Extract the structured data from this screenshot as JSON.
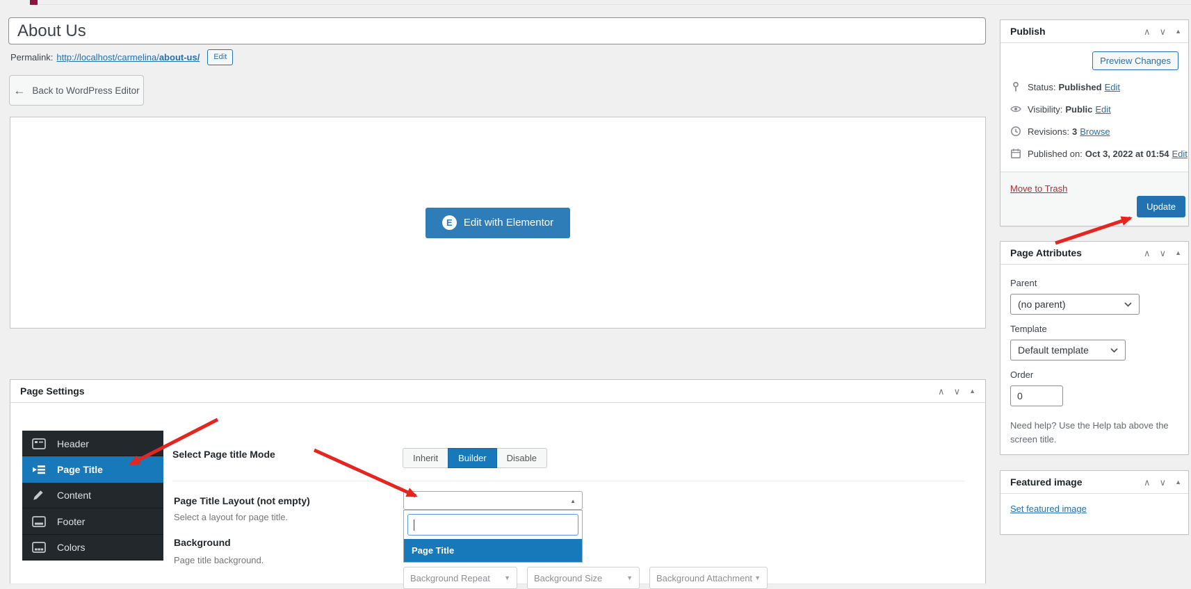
{
  "title_input": {
    "value": "About Us"
  },
  "permalink": {
    "label": "Permalink:",
    "url_base": "http://localhost/carmelina/",
    "slug": "about-us/",
    "edit_button": "Edit"
  },
  "back_button": {
    "arrow": "←",
    "label": "Back to WordPress Editor"
  },
  "elementor": {
    "icon_letter": "E",
    "button_label": "Edit with Elementor"
  },
  "publish": {
    "title": "Publish",
    "preview_button": "Preview Changes",
    "rows": [
      {
        "icon": "pin-icon",
        "label": "Status:",
        "value": "Published",
        "action": "Edit"
      },
      {
        "icon": "eye-icon",
        "label": "Visibility:",
        "value": "Public",
        "action": "Edit"
      },
      {
        "icon": "revisions-icon",
        "label": "Revisions:",
        "value": "3",
        "action": "Browse"
      },
      {
        "icon": "calendar-icon",
        "label": "Published on:",
        "value": "Oct 3, 2022 at 01:54",
        "action": "Edit"
      }
    ],
    "move_to_trash": "Move to Trash",
    "update_button": "Update"
  },
  "attributes": {
    "title": "Page Attributes",
    "parent_label": "Parent",
    "parent_value": "(no parent)",
    "template_label": "Template",
    "template_value": "Default template",
    "order_label": "Order",
    "order_value": "0",
    "help_text": "Need help? Use the Help tab above the screen title."
  },
  "featured": {
    "title": "Featured image",
    "set_link": "Set featured image"
  },
  "settings": {
    "title": "Page Settings",
    "tabs": [
      {
        "label": "Header"
      },
      {
        "label": "Page Title"
      },
      {
        "label": "Content"
      },
      {
        "label": "Footer"
      },
      {
        "label": "Colors"
      }
    ],
    "mode": {
      "label": "Select Page title Mode",
      "options": [
        "Inherit",
        "Builder",
        "Disable"
      ],
      "selected": "Builder"
    },
    "layout": {
      "label": "Page Title Layout (not empty)",
      "description": "Select a layout for page title.",
      "search_value": "",
      "highlighted_option": "Page Title"
    },
    "background": {
      "label": "Background",
      "description": "Page title background.",
      "selects": [
        "Background Repeat",
        "Background Size",
        "Background Attachment"
      ]
    }
  },
  "panel_icons": {
    "up": "∧",
    "down": "∨",
    "toggle": "▲"
  },
  "colors": {
    "wp_blue": "#2271b1",
    "tab_blue": "#1779ba",
    "elementor_blue": "#2e7cb8",
    "arrow_red": "#e52620",
    "trash_red": "#b32d2e",
    "sidebar_dark": "#23282d"
  }
}
